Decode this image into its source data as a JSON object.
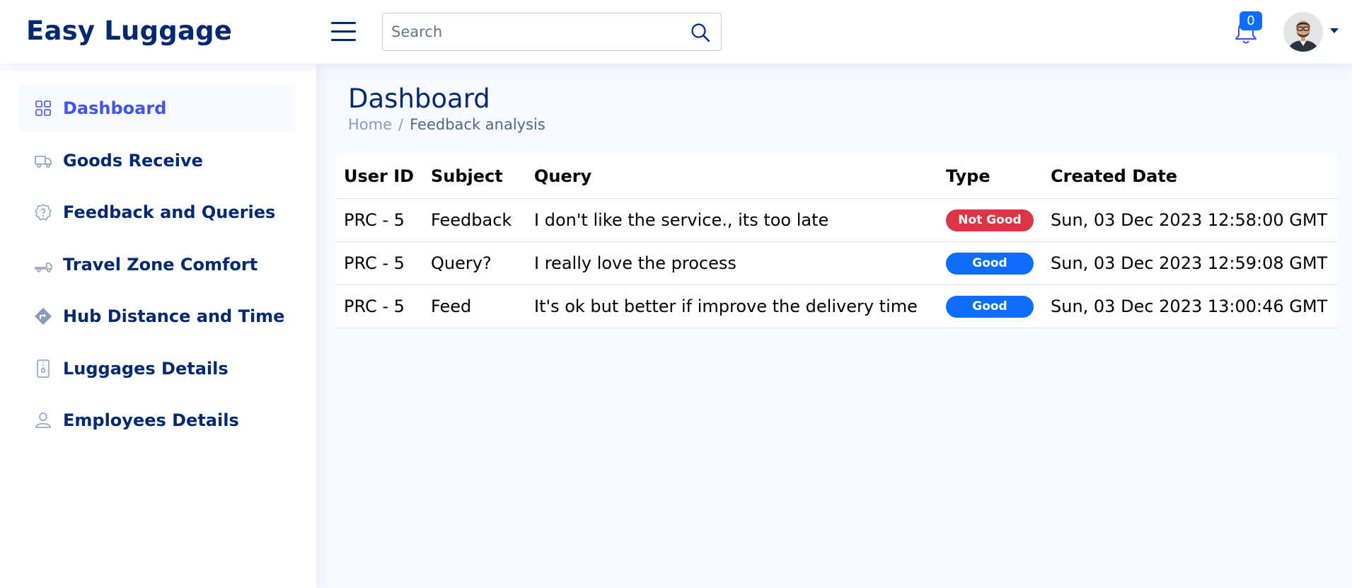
{
  "app": {
    "logo": "Easy Luggage"
  },
  "header": {
    "search_placeholder": "Search",
    "notification_count": "0"
  },
  "sidebar": {
    "items": [
      {
        "label": "Dashboard",
        "icon": "grid-icon",
        "active": true
      },
      {
        "label": "Goods Receive",
        "icon": "truck-icon"
      },
      {
        "label": "Feedback and Queries",
        "icon": "question-badge-icon"
      },
      {
        "label": "Travel Zone Comfort",
        "icon": "truck-flatbed-icon"
      },
      {
        "label": "Hub Distance and Time",
        "icon": "sign-turn-right-icon"
      },
      {
        "label": "Luggages Details",
        "icon": "file-zip-icon"
      },
      {
        "label": "Employees Details",
        "icon": "person-icon"
      }
    ]
  },
  "page": {
    "title": "Dashboard",
    "breadcrumb": {
      "home": "Home",
      "current": "Feedback analysis"
    }
  },
  "table": {
    "headers": [
      "User ID",
      "Subject",
      "Query",
      "Type",
      "Created Date"
    ],
    "rows": [
      {
        "user_id": "PRC - 5",
        "subject": "Feedback",
        "query": "I don't like the service., its too late",
        "type": "Not Good",
        "type_color": "#dc3545",
        "created": "Sun, 03 Dec 2023 12:58:00 GMT"
      },
      {
        "user_id": "PRC - 5",
        "subject": "Query?",
        "query": "I really love the process",
        "type": "Good",
        "type_color": "#0d6efd",
        "created": "Sun, 03 Dec 2023 12:59:08 GMT"
      },
      {
        "user_id": "PRC - 5",
        "subject": "Feed",
        "query": "It's ok but better if improve the delivery time",
        "type": "Good",
        "type_color": "#0d6efd",
        "created": "Sun, 03 Dec 2023 13:00:46 GMT"
      }
    ]
  },
  "colors": {
    "primary_text": "#012970",
    "active_link": "#4154f1",
    "badge_danger": "#dc3545",
    "badge_primary": "#0d6efd",
    "page_background": "#f6f9ff"
  }
}
